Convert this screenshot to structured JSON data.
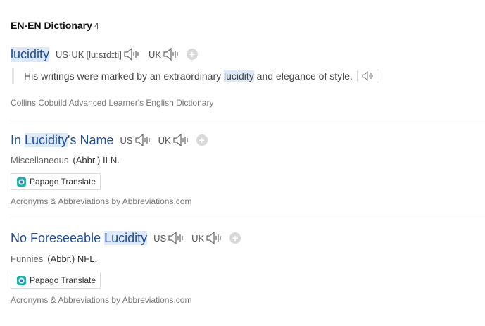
{
  "section": {
    "title": "EN-EN Dictionary",
    "count": "4"
  },
  "entries": [
    {
      "headword": "lucidity",
      "pron_us_uk": "US·UK",
      "ipa": "[luːsɪdɪti]",
      "pron_uk": "UK",
      "example": {
        "before": "His writings were marked by an extraordinary ",
        "highlight": "lucidity",
        "after": " and elegance of style."
      },
      "source": "Collins Cobuild Advanced Learner's English Dictionary"
    },
    {
      "headword_before": "In ",
      "headword_highlight": "Lucidity",
      "headword_after": "'s Name",
      "pron_us": "US",
      "pron_uk": "UK",
      "category": "Miscellaneous",
      "abbr": "(Abbr.) ILN.",
      "translate_label": "Papago Translate",
      "source": "Acronyms & Abbreviations by Abbreviations.com"
    },
    {
      "headword_before": "No Foreseeable ",
      "headword_highlight": "Lucidity",
      "pron_us": "US",
      "pron_uk": "UK",
      "category": "Funnies",
      "abbr": "(Abbr.) NFL.",
      "translate_label": "Papago Translate",
      "source": "Acronyms & Abbreviations by Abbreviations.com"
    }
  ],
  "icons": {
    "speaker": "speaker-icon",
    "add": "plus-icon",
    "papago": "papago-logo-icon"
  }
}
